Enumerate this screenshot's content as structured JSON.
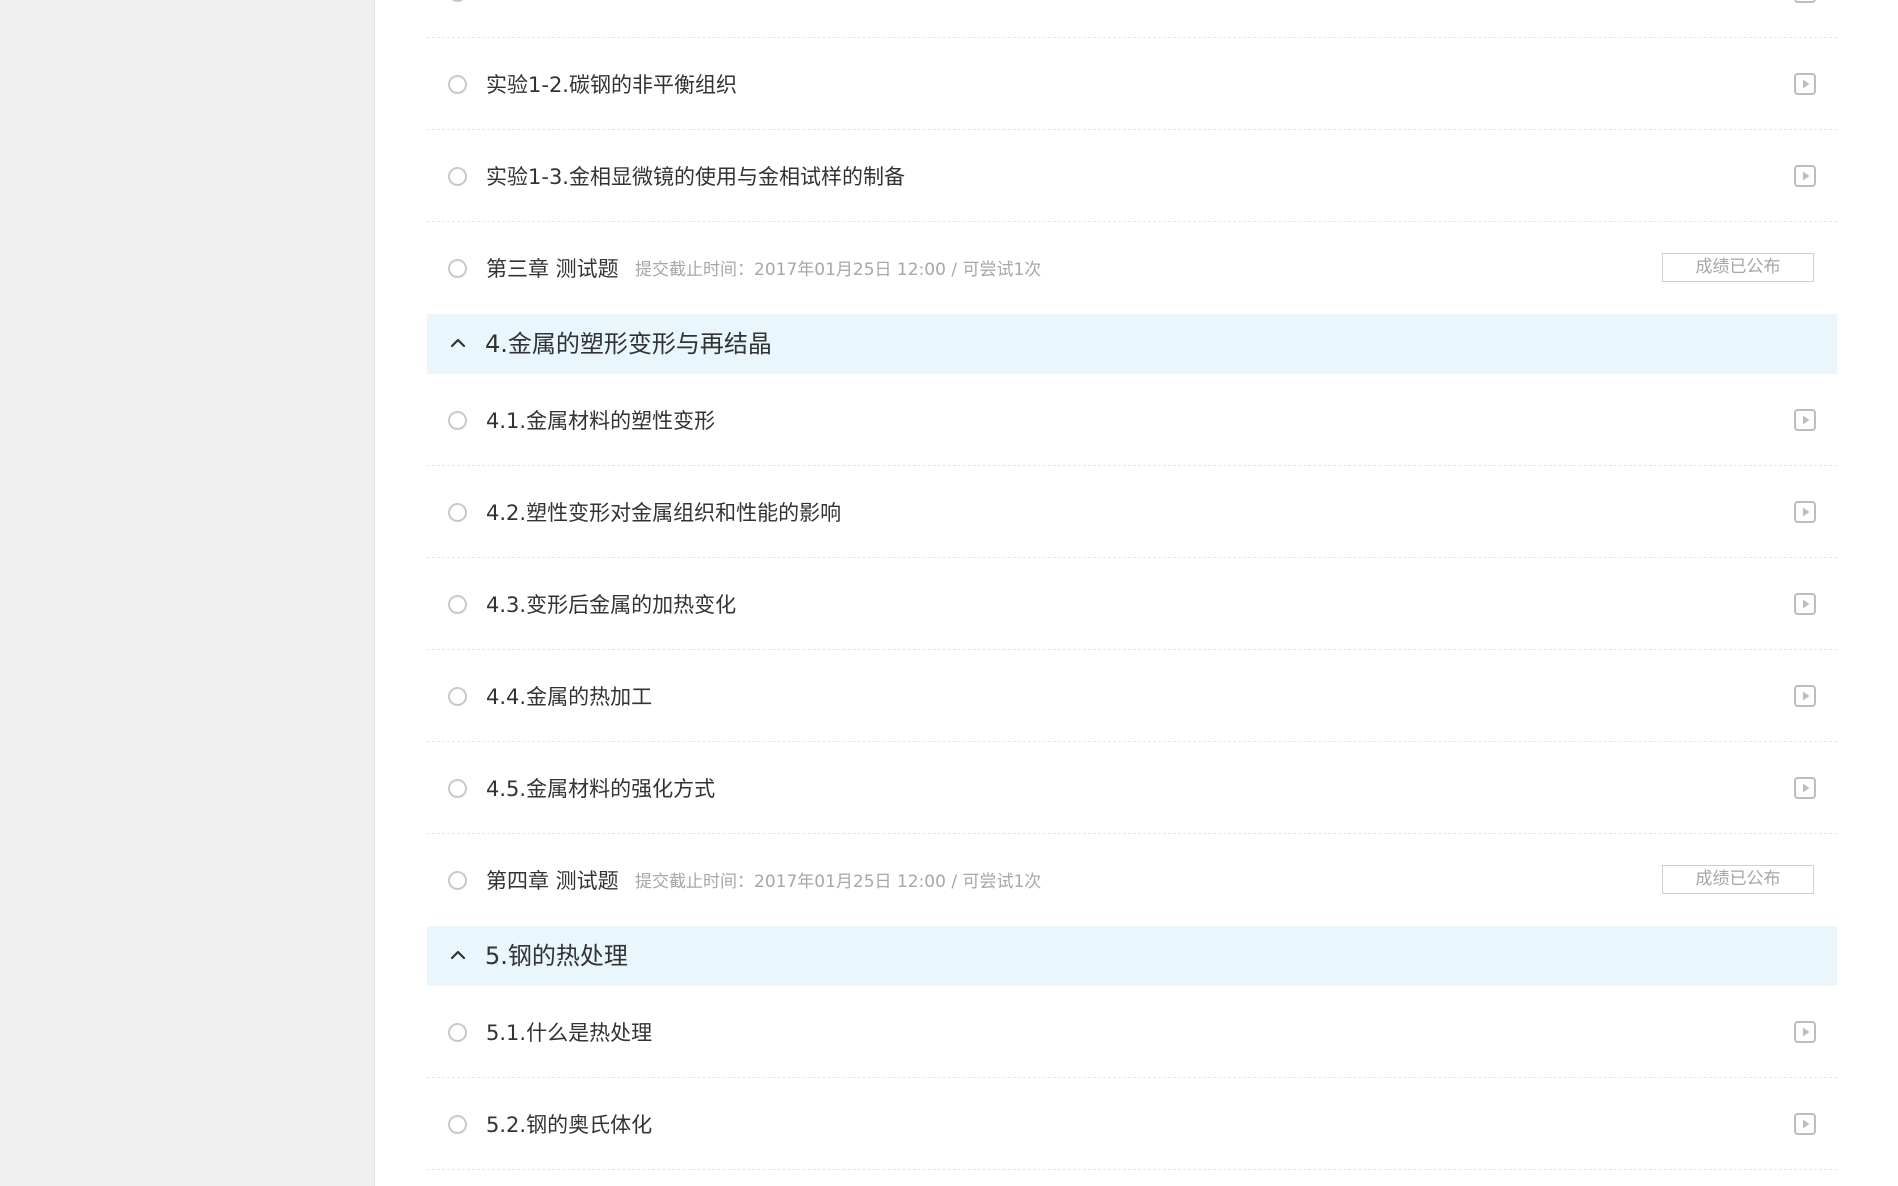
{
  "rows_top": [
    {
      "label": "实验1-2.碳钢的非平衡组织"
    },
    {
      "label": "实验1-3.金相显微镜的使用与金相试样的制备"
    }
  ],
  "quiz3": {
    "label": "第三章 测试题",
    "meta": "提交截止时间：2017年01月25日 12:00 / 可尝试1次",
    "status": "成绩已公布"
  },
  "chapter4": {
    "title": "4.金属的塑形变形与再结晶",
    "lessons": [
      {
        "label": "4.1.金属材料的塑性变形"
      },
      {
        "label": "4.2.塑性变形对金属组织和性能的影响"
      },
      {
        "label": "4.3.变形后金属的加热变化"
      },
      {
        "label": "4.4.金属的热加工"
      },
      {
        "label": "4.5.金属材料的强化方式"
      }
    ]
  },
  "quiz4": {
    "label": "第四章 测试题",
    "meta": "提交截止时间：2017年01月25日 12:00 / 可尝试1次",
    "status": "成绩已公布"
  },
  "chapter5": {
    "title": "5.钢的热处理",
    "lessons": [
      {
        "label": "5.1.什么是热处理"
      },
      {
        "label": "5.2.钢的奥氏体化"
      }
    ]
  },
  "icons": {
    "status": "progress-circle-icon",
    "video": "video-play-icon",
    "collapse": "chevron-up-icon"
  }
}
